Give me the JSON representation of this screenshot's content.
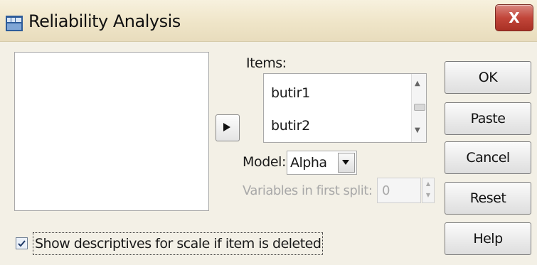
{
  "window": {
    "title": "Reliability Analysis",
    "close_label": "X"
  },
  "items": {
    "label": "Items:",
    "list": [
      "butir1",
      "butir2"
    ]
  },
  "model": {
    "label": "Model:",
    "value": "Alpha"
  },
  "split": {
    "label": "Variables in first split:",
    "value": "0"
  },
  "buttons": {
    "ok": "OK",
    "paste": "Paste",
    "cancel": "Cancel",
    "reset": "Reset",
    "help": "Help"
  },
  "checkbox": {
    "label": "Show descriptives for scale if item is deleted",
    "checked": true
  }
}
